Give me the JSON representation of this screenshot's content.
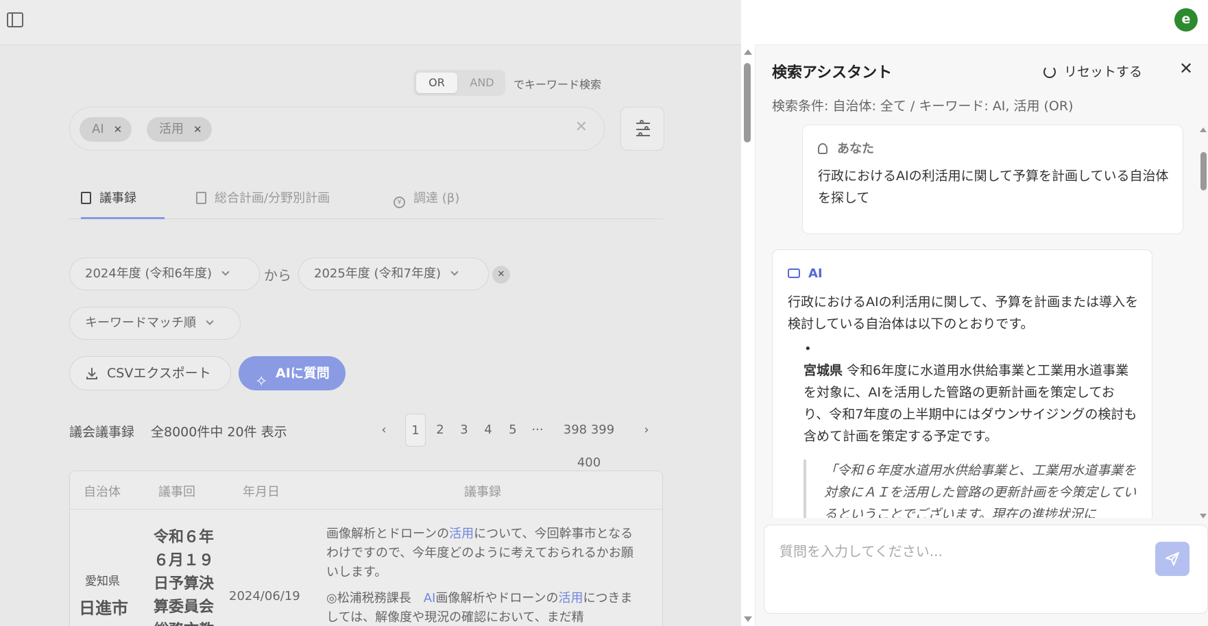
{
  "search": {
    "mode_options": [
      "OR",
      "AND"
    ],
    "mode_selected": "OR",
    "mode_hint": "でキーワード検索",
    "keywords": [
      "AI",
      "活用"
    ]
  },
  "tabs": [
    {
      "label": "議事録",
      "active": true
    },
    {
      "label": "総合計画/分野別計画",
      "active": false
    },
    {
      "label": "調達 (β)",
      "active": false
    }
  ],
  "filters": {
    "year_from": "2024年度 (令和6年度)",
    "range_sep": "から",
    "year_to": "2025年度 (令和7年度)",
    "sort": "キーワードマッチ順"
  },
  "actions": {
    "csv_label": "CSVエクスポート",
    "ai_label": "AIに質問"
  },
  "results": {
    "label": "議会議事録",
    "count_text": "全8000件中 20件 表示",
    "pages": [
      "1",
      "2",
      "3",
      "4",
      "5"
    ],
    "ellipsis": "···",
    "last_pages": "398 399 400",
    "current_page": "1"
  },
  "table": {
    "headers": [
      "自治体",
      "議事回",
      "年月日",
      "議事録"
    ],
    "row": {
      "prefecture": "愛知県",
      "city": "日進市",
      "session": "令和６年６月１９日予算決算委員会総務文教",
      "date": "2024/06/19",
      "para1_a": "画像解析とドローンの",
      "para1_hl": "活用",
      "para1_b": "について、今回幹事市となるわけですので、今年度どのように考えておられるかお願いします。",
      "para2_a": "◎松浦税務課長　",
      "para2_hl1": "AI",
      "para2_b": "画像解析やドローンの",
      "para2_hl2": "活用",
      "para2_c": "につきましては、解像度や現況の確認において、まだ精"
    }
  },
  "assistant": {
    "avatar_letter": "e",
    "title": "検索アシスタント",
    "reset_label": "リセットする",
    "close_glyph": "✕",
    "conditions": "検索条件: 自治体: 全て / キーワード: AI, 活用 (OR)",
    "user_name": "あなた",
    "user_text": "行政におけるAIの利活用に関して予算を計画している自治体を探して",
    "ai_name": "AI",
    "ai_intro": "行政におけるAIの利活用に関して、予算を計画または導入を検討している自治体は以下のとおりです。",
    "bullet": "•",
    "item_pref": "宮城県",
    "item_text": " 令和6年度に水道用水供給事業と工業用水道事業を対象に、AIを活用した管路の更新計画を策定しており、令和7年度の上半期中にはダウンサイジングの検討も含めて計画を策定する予定です。",
    "quote": "「令和６年度水道用水供給事業と、工業用水道事業を対象にＡＩを活用した管路の更新計画を今策定しているということでございます。現在の進捗状況に",
    "input_placeholder": "質問を入力してください..."
  },
  "colors": {
    "accent": "#8a9be4",
    "highlight": "#6f86de",
    "avatar": "#2e8a2e"
  }
}
